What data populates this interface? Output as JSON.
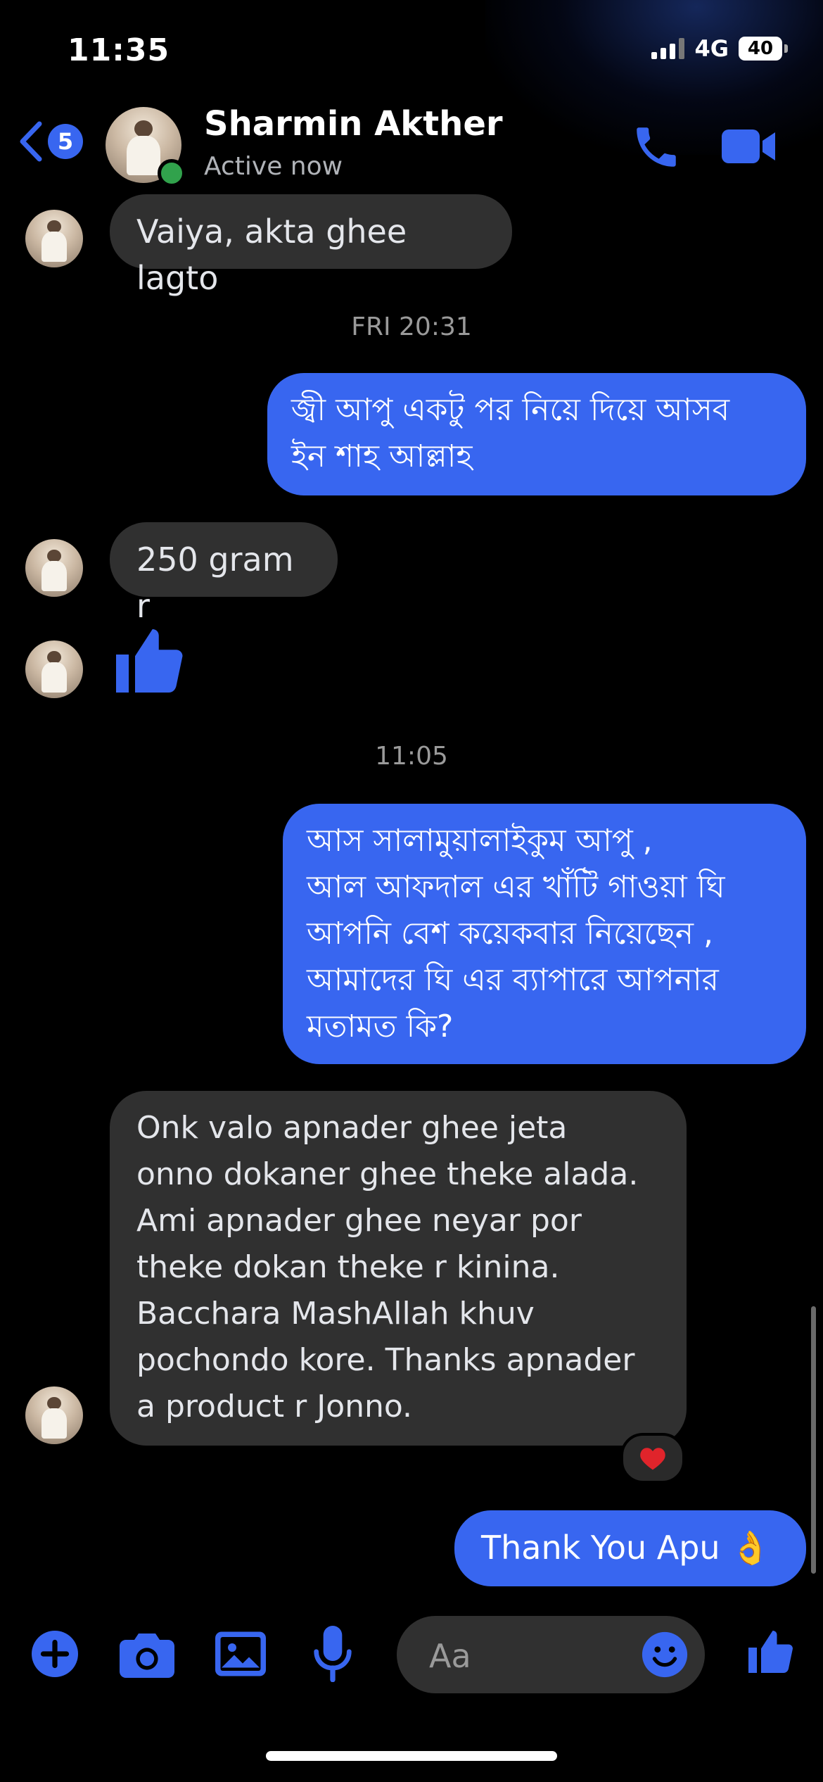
{
  "status_bar": {
    "time": "11:35",
    "network": "4G",
    "battery": "40"
  },
  "header": {
    "back_badge_count": "5",
    "contact_name": "Sharmin Akther",
    "contact_status": "Active now"
  },
  "messages": {
    "m1": "Vaiya, akta ghee lagto",
    "ts1": "FRI 20:31",
    "m2": "জ্বী আপু একটু পর নিয়ে দিয়ে আসব\nইন শাহ আল্লাহ",
    "m3": "250 gram r",
    "ts2": "11:05",
    "m5": "আস সালামুয়ালাইকুম আপু ,\nআল আফদাল এর খাঁটি গাওয়া ঘি\nআপনি বেশ কয়েকবার নিয়েছেন ,\nআমাদের ঘি এর ব্যাপারে আপনার\nমতামত কি?",
    "m6": "Onk valo apnader ghee jeta\nonno dokaner ghee theke alada.\nAmi apnader ghee neyar por\ntheke dokan theke r kinina.\nBacchara MashAllah khuv\npochondo kore. Thanks apnader\na product r Jonno.",
    "m7": "Thank You Apu 👌"
  },
  "composer": {
    "placeholder": "Aa"
  },
  "colors": {
    "accent": "#3866f0",
    "incoming_bubble": "#303030",
    "online": "#31a24c",
    "reaction_heart": "#e0242b"
  },
  "icons": {
    "back": "chevron-left-icon",
    "call": "phone-icon",
    "video": "video-camera-icon",
    "reaction": "heart-icon",
    "like": "thumbs-up-icon",
    "add": "plus-circle-icon",
    "camera": "camera-icon",
    "gallery": "image-icon",
    "voice": "microphone-icon",
    "emoji": "smiley-icon"
  }
}
